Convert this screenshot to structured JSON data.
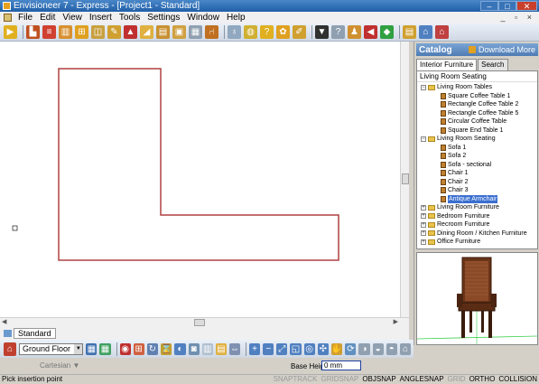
{
  "window": {
    "title": "Envisioneer 7 - Express - [Project1 - Standard]",
    "min": "–",
    "max": "□",
    "close": "✕"
  },
  "menu": [
    "File",
    "Edit",
    "View",
    "Insert",
    "Tools",
    "Settings",
    "Window",
    "Help"
  ],
  "mdi_controls": "_ ▫ ×",
  "toolbar_icons": [
    {
      "name": "select-arrow-icon",
      "color": "#e0b020",
      "glyph": "▶"
    },
    {
      "name": "wall-tool-icon",
      "color": "#c05020",
      "glyph": "▙"
    },
    {
      "name": "stairs-icon",
      "color": "#d04030",
      "glyph": "≡"
    },
    {
      "name": "column-icon",
      "color": "#d89030",
      "glyph": "▥"
    },
    {
      "name": "window-tool-icon",
      "color": "#e0a020",
      "glyph": "⊞"
    },
    {
      "name": "door-tool-icon",
      "color": "#c8a040",
      "glyph": "◫"
    },
    {
      "name": "pen-icon",
      "color": "#d0a030",
      "glyph": "✎"
    },
    {
      "name": "roof-icon",
      "color": "#c03030",
      "glyph": "▲"
    },
    {
      "name": "deck-icon",
      "color": "#e0b040",
      "glyph": "◢"
    },
    {
      "name": "cabinet-icon",
      "color": "#c89030",
      "glyph": "▤"
    },
    {
      "name": "appliance-icon",
      "color": "#d0a040",
      "glyph": "▣"
    },
    {
      "name": "picture-icon",
      "color": "#90a0b0",
      "glyph": "▦"
    },
    {
      "name": "chair-icon",
      "color": "#c07020",
      "glyph": "⑁"
    },
    {
      "name": "lamp-icon",
      "color": "#90a8c0",
      "glyph": "♁"
    },
    {
      "name": "plumbing-icon",
      "color": "#d0b030",
      "glyph": "◍"
    },
    {
      "name": "help-icon",
      "color": "#e0b020",
      "glyph": "?"
    },
    {
      "name": "plant-icon",
      "color": "#e0a020",
      "glyph": "✿"
    },
    {
      "name": "annotation-icon",
      "color": "#d0a030",
      "glyph": "✐"
    },
    {
      "name": "graduation-cap-icon",
      "color": "#303030",
      "glyph": "▼"
    },
    {
      "name": "help-arrow-icon",
      "color": "#90a0b0",
      "glyph": "?"
    },
    {
      "name": "people-icon",
      "color": "#d09030",
      "glyph": "♟"
    },
    {
      "name": "arrow-back-icon",
      "color": "#c03030",
      "glyph": "◀"
    },
    {
      "name": "landscape-icon",
      "color": "#30a040",
      "glyph": "◆"
    },
    {
      "name": "layers-icon",
      "color": "#d0a030",
      "glyph": "▤"
    },
    {
      "name": "home-icon",
      "color": "#5080c0",
      "glyph": "⌂"
    },
    {
      "name": "house-settings-icon",
      "color": "#c04040",
      "glyph": "⌂"
    }
  ],
  "catalog": {
    "title": "Catalog",
    "download_more": "Download More",
    "tabs": [
      "Interior Furniture",
      "Search"
    ],
    "path": "Living Room Seating",
    "tree": [
      {
        "indent": 0,
        "type": "folder",
        "toggle": "−",
        "label": "Living Room Tables"
      },
      {
        "indent": 1,
        "type": "item",
        "label": "Square Coffee Table 1"
      },
      {
        "indent": 1,
        "type": "item",
        "label": "Rectangle Coffee Table 2"
      },
      {
        "indent": 1,
        "type": "item",
        "label": "Rectangle Coffee Table 5"
      },
      {
        "indent": 1,
        "type": "item",
        "label": "Circular Coffee Table"
      },
      {
        "indent": 1,
        "type": "item",
        "label": "Square End Table 1"
      },
      {
        "indent": 0,
        "type": "folder",
        "toggle": "−",
        "label": "Living Room Seating"
      },
      {
        "indent": 1,
        "type": "item",
        "label": "Sofa 1"
      },
      {
        "indent": 1,
        "type": "item",
        "label": "Sofa 2"
      },
      {
        "indent": 1,
        "type": "item",
        "label": "Sofa - sectional"
      },
      {
        "indent": 1,
        "type": "item",
        "label": "Chair 1"
      },
      {
        "indent": 1,
        "type": "item",
        "label": "Chair 2"
      },
      {
        "indent": 1,
        "type": "item",
        "label": "Chair 3"
      },
      {
        "indent": 1,
        "type": "item",
        "label": "Antique Armchair",
        "selected": true
      },
      {
        "indent": 0,
        "type": "folder",
        "toggle": "+",
        "label": "Living Room Furniture"
      },
      {
        "indent": 0,
        "type": "folder",
        "toggle": "+",
        "label": "Bedroom Furniture"
      },
      {
        "indent": 0,
        "type": "folder",
        "toggle": "+",
        "label": "Recroom Furniture"
      },
      {
        "indent": 0,
        "type": "folder",
        "toggle": "+",
        "label": "Dining Room / Kitchen Furniture"
      },
      {
        "indent": 0,
        "type": "folder",
        "toggle": "+",
        "label": "Office Furniture"
      }
    ]
  },
  "view_tab": "Standard",
  "floor": "Ground Floor",
  "bottom_icons": [
    {
      "name": "2d-view-icon",
      "color": "#4070b0",
      "glyph": "▦"
    },
    {
      "name": "3d-view-icon",
      "color": "#40a060",
      "glyph": "▦"
    },
    {
      "name": "render-icon",
      "color": "#c03030",
      "glyph": "◉"
    },
    {
      "name": "grid-icon",
      "color": "#d06040",
      "glyph": "⊞"
    },
    {
      "name": "rotate-icon",
      "color": "#6080b0",
      "glyph": "↻"
    },
    {
      "name": "walkthrough-icon",
      "color": "#c0a030",
      "glyph": "⌛"
    },
    {
      "name": "material-icon",
      "color": "#5080c0",
      "glyph": "◐"
    },
    {
      "name": "camera-icon",
      "color": "#7090b0",
      "glyph": "◙"
    },
    {
      "name": "wall-display-icon",
      "color": "#b0c0d0",
      "glyph": "▥"
    },
    {
      "name": "floor-display-icon",
      "color": "#e0b040",
      "glyph": "▤"
    },
    {
      "name": "view-angle-icon",
      "color": "#8090b0",
      "glyph": "⇔"
    },
    {
      "name": "zoom-in-icon",
      "color": "#5080c0",
      "glyph": "+"
    },
    {
      "name": "zoom-out-icon",
      "color": "#5080c0",
      "glyph": "−"
    },
    {
      "name": "zoom-extents-icon",
      "color": "#5080c0",
      "glyph": "⤢"
    },
    {
      "name": "zoom-window-icon",
      "color": "#5080c0",
      "glyph": "◱"
    },
    {
      "name": "zoom-selection-icon",
      "color": "#5080c0",
      "glyph": "◎"
    },
    {
      "name": "pan-icon",
      "color": "#5080c0",
      "glyph": "✣"
    },
    {
      "name": "hand-icon",
      "color": "#d0a030",
      "glyph": "✋"
    },
    {
      "name": "orbit-icon",
      "color": "#6090c0",
      "glyph": "⟳"
    },
    {
      "name": "look-icon",
      "color": "#90a0b0",
      "glyph": "◑"
    },
    {
      "name": "walk-icon",
      "color": "#90a0b0",
      "glyph": "◒"
    },
    {
      "name": "fly-icon",
      "color": "#90a0b0",
      "glyph": "◓"
    },
    {
      "name": "home-view-icon",
      "color": "#90a0b0",
      "glyph": "⌂"
    }
  ],
  "coordinate_mode": "Cartesian",
  "base_height_label": "Base Height",
  "base_height_value": "0 mm",
  "status_message": "Pick insertion point",
  "status_flags": [
    {
      "label": "SNAPTRACK",
      "on": false
    },
    {
      "label": "GRIDSNAP",
      "on": false
    },
    {
      "label": "OBJSNAP",
      "on": true
    },
    {
      "label": "ANGLESNAP",
      "on": true
    },
    {
      "label": "GRID",
      "on": false
    },
    {
      "label": "ORTHO",
      "on": true
    },
    {
      "label": "COLLISION",
      "on": true
    }
  ]
}
